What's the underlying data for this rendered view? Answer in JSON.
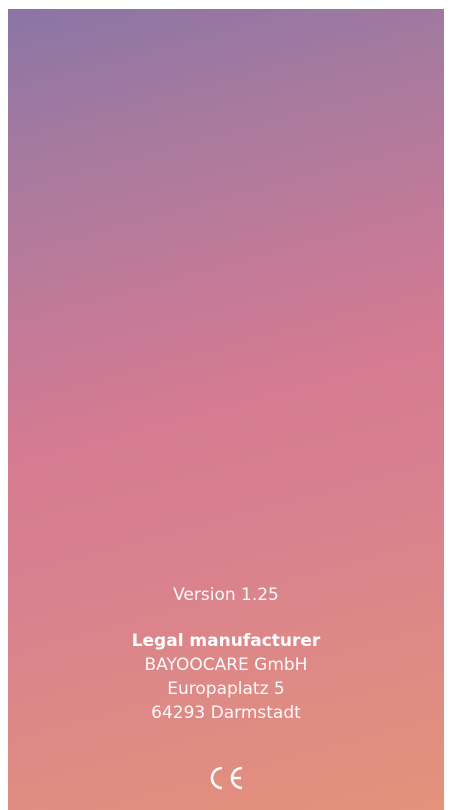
{
  "about": {
    "version_text": "Version 1.25",
    "legal_title": "Legal manufacturer",
    "company": "BAYOOCARE GmbH",
    "street": "Europaplatz 5",
    "city": "64293 Darmstadt",
    "certification_icon": "ce-mark-icon"
  },
  "colors": {
    "gradient_top": "#8a75a5",
    "gradient_middle": "#d67b91",
    "gradient_bottom": "#e4927b",
    "text": "#ffffff"
  }
}
